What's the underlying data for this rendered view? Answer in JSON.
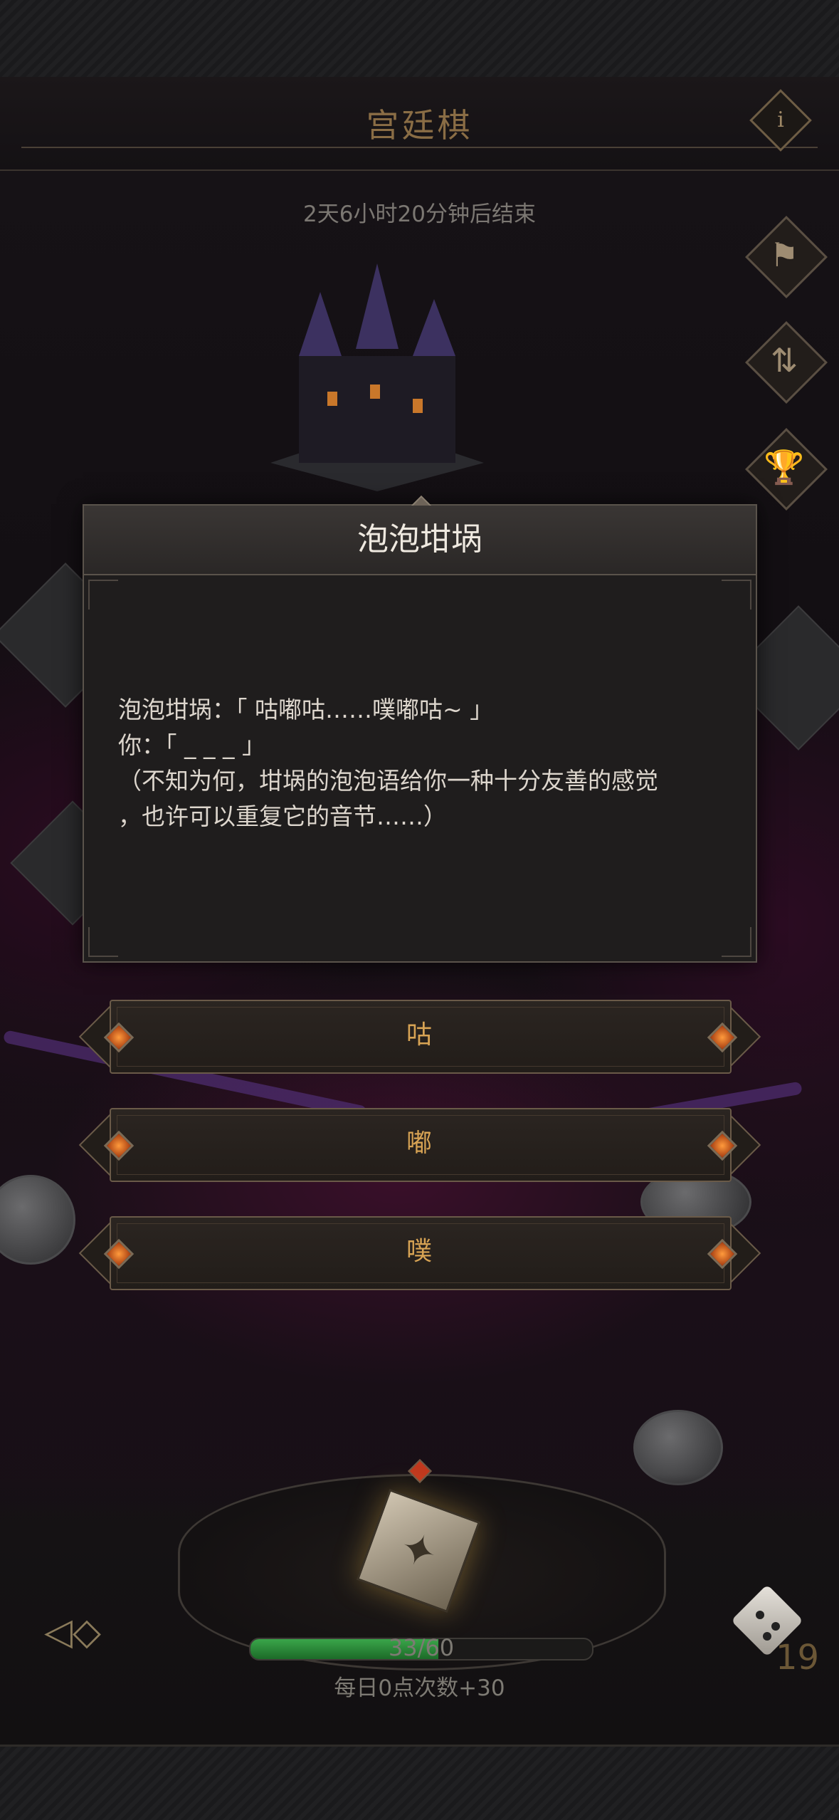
{
  "header": {
    "title": "宫廷棋",
    "info_icon": "i",
    "timer": "2天6小时20分钟后结束"
  },
  "side_icons": [
    {
      "name": "banner-icon",
      "glyph": "⚑"
    },
    {
      "name": "swap-arrows-icon",
      "glyph": "⇅"
    },
    {
      "name": "trophy-icon",
      "glyph": "🏆"
    }
  ],
  "dialog": {
    "title": "泡泡坩埚",
    "lines": [
      "泡泡坩埚：「 咕嘟咕……噗嘟咕~ 」",
      "你：「 _ _ _ 」",
      "（不知为何，坩埚的泡泡语给你一种十分友善的感觉",
      "，也许可以重复它的音节……）"
    ]
  },
  "options": [
    "咕",
    "嘟",
    "噗"
  ],
  "bottom": {
    "progress_text": "33/60",
    "progress_value": 33,
    "progress_max": 60,
    "reset_text": "每日0点次数+30",
    "dice_count": "19"
  },
  "colors": {
    "accent_gold": "#d7a354",
    "progress_green": "#3aa54a",
    "gem_orange": "#ff9a3c"
  }
}
